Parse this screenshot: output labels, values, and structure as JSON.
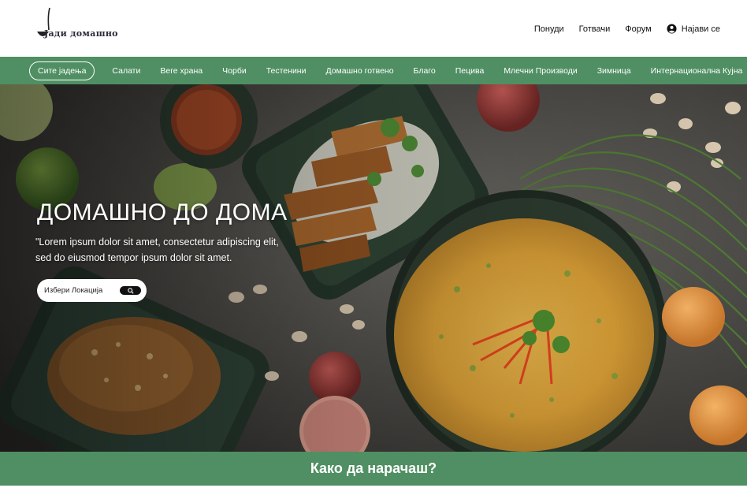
{
  "brand": {
    "logo_text": "Јади домашно"
  },
  "top_nav": {
    "offers": "Понуди",
    "cooks": "Готвачи",
    "forum": "Форум",
    "login": "Најави се"
  },
  "categories": [
    {
      "label": "Сите јадења",
      "active": true
    },
    {
      "label": "Салати"
    },
    {
      "label": "Веге храна"
    },
    {
      "label": "Чорби"
    },
    {
      "label": "Тестенини"
    },
    {
      "label": "Домашно готвено"
    },
    {
      "label": "Благо"
    },
    {
      "label": "Пецива"
    },
    {
      "label": "Млечни Производи"
    },
    {
      "label": "Зимница"
    },
    {
      "label": "Интернационална Кујна"
    }
  ],
  "hero": {
    "title": "ДОМАШНО ДО ДОМА",
    "text": "\"Lorem ipsum dolor sit amet, consectetur adipiscing elit, sed do eiusmod tempor ipsum dolor sit amet.",
    "search_placeholder": "Избери Локација"
  },
  "how_to": {
    "title": "Како да нарачаш?"
  },
  "colors": {
    "accent": "#4f8f63",
    "header_bg": "#ffffff"
  },
  "icons": {
    "login": "user-circle-icon",
    "search": "search-icon",
    "logo": "ladle-icon"
  }
}
